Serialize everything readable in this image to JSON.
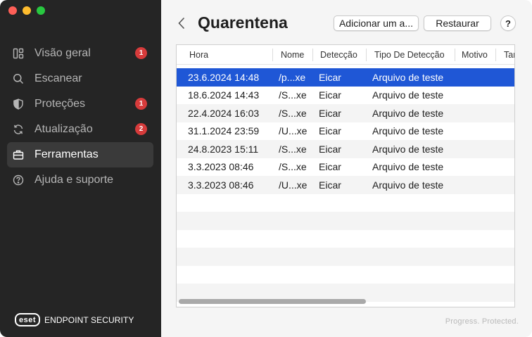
{
  "sidebar": {
    "items": [
      {
        "label": "Visão geral",
        "icon": "dashboard-icon",
        "badge": "1"
      },
      {
        "label": "Escanear",
        "icon": "search-icon",
        "badge": ""
      },
      {
        "label": "Proteções",
        "icon": "shield-icon",
        "badge": "1"
      },
      {
        "label": "Atualização",
        "icon": "refresh-icon",
        "badge": "2"
      },
      {
        "label": "Ferramentas",
        "icon": "briefcase-icon",
        "badge": ""
      },
      {
        "label": "Ajuda e suporte",
        "icon": "help-circle-icon",
        "badge": ""
      }
    ],
    "active_index": 4,
    "brand": {
      "logo": "eset",
      "product": "ENDPOINT SECURITY"
    }
  },
  "header": {
    "title": "Quarentena",
    "add_button": "Adicionar um a...",
    "restore_button": "Restaurar",
    "help_button": "?"
  },
  "table": {
    "columns": [
      "Hora",
      "Nome",
      "Detecção",
      "Tipo De Detecção",
      "Motivo",
      "Tam"
    ],
    "rows": [
      {
        "time": "23.6.2024 14:48",
        "name": "/p...xe",
        "detection": "Eicar",
        "type": "Arquivo de teste",
        "selected": true
      },
      {
        "time": "18.6.2024 14:43",
        "name": "/S...xe",
        "detection": "Eicar",
        "type": "Arquivo de teste"
      },
      {
        "time": "22.4.2024 16:03",
        "name": "/S...xe",
        "detection": "Eicar",
        "type": "Arquivo de teste"
      },
      {
        "time": "31.1.2024 23:59",
        "name": "/U...xe",
        "detection": "Eicar",
        "type": "Arquivo de teste"
      },
      {
        "time": "24.8.2023 15:11",
        "name": "/S...xe",
        "detection": "Eicar",
        "type": "Arquivo de teste"
      },
      {
        "time": "3.3.2023 08:46",
        "name": "/S...xe",
        "detection": "Eicar",
        "type": "Arquivo de teste"
      },
      {
        "time": "3.3.2023 08:46",
        "name": "/U...xe",
        "detection": "Eicar",
        "type": "Arquivo de teste"
      }
    ],
    "empty_rows": 6
  },
  "footer": {
    "tagline": "Progress. Protected."
  },
  "colors": {
    "sidebar_bg": "#252525",
    "selection": "#1f57d6",
    "badge": "#d63b3b"
  }
}
